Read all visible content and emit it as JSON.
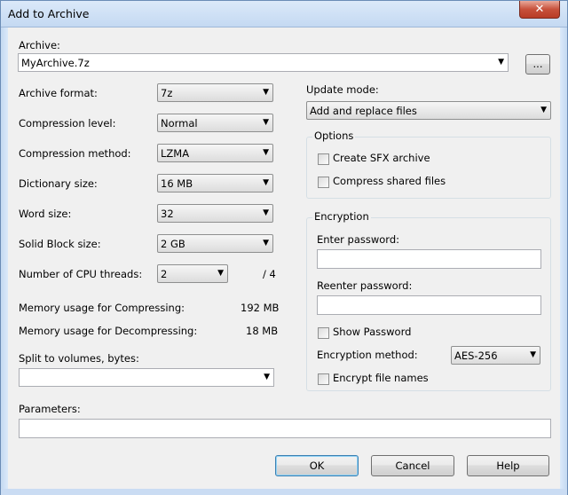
{
  "window": {
    "title": "Add to Archive",
    "close_glyph": "✕"
  },
  "archive": {
    "label": "Archive:",
    "value": "MyArchive.7z",
    "browse_label": "..."
  },
  "left": {
    "format": {
      "label": "Archive format:",
      "value": "7z"
    },
    "level": {
      "label": "Compression level:",
      "value": "Normal"
    },
    "method": {
      "label": "Compression method:",
      "value": "LZMA"
    },
    "dict": {
      "label": "Dictionary size:",
      "value": "16 MB"
    },
    "word": {
      "label": "Word size:",
      "value": "32"
    },
    "solid": {
      "label": "Solid Block size:",
      "value": "2 GB"
    },
    "threads": {
      "label": "Number of CPU threads:",
      "value": "2",
      "max": "/ 4"
    },
    "mem_comp": {
      "label": "Memory usage for Compressing:",
      "value": "192 MB"
    },
    "mem_decomp": {
      "label": "Memory usage for Decompressing:",
      "value": "18 MB"
    },
    "split": {
      "label": "Split to volumes, bytes:",
      "value": ""
    }
  },
  "update": {
    "label": "Update mode:",
    "value": "Add and replace files"
  },
  "options": {
    "title": "Options",
    "sfx_label": "Create SFX archive",
    "shared_label": "Compress shared files"
  },
  "encryption": {
    "title": "Encryption",
    "enter_label": "Enter password:",
    "reenter_label": "Reenter password:",
    "show_label": "Show Password",
    "method_label": "Encryption method:",
    "method_value": "AES-256",
    "names_label": "Encrypt file names"
  },
  "parameters": {
    "label": "Parameters:",
    "value": ""
  },
  "buttons": {
    "ok": "OK",
    "cancel": "Cancel",
    "help": "Help"
  },
  "icons": {
    "dropdown": "▼"
  }
}
